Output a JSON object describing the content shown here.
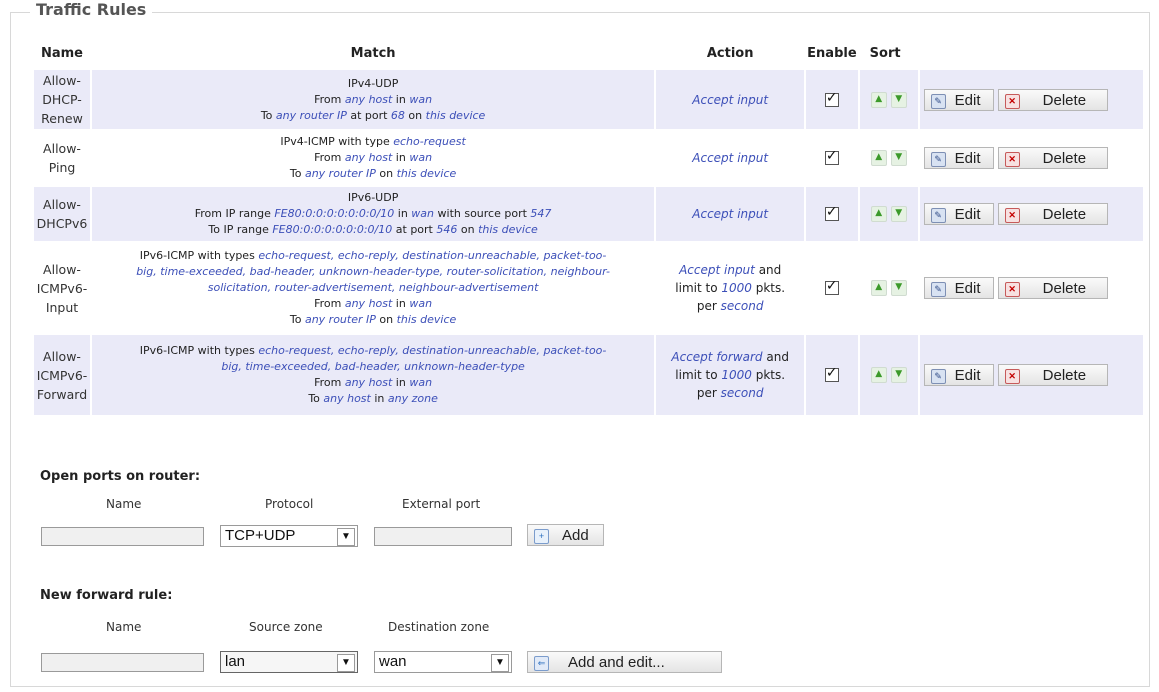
{
  "legend": "Traffic Rules",
  "columns": {
    "name": "Name",
    "match": "Match",
    "action": "Action",
    "enable": "Enable",
    "sort": "Sort"
  },
  "buttons": {
    "edit": "Edit",
    "delete": "Delete",
    "add": "Add",
    "add_edit": "Add and edit..."
  },
  "rules": [
    {
      "name": [
        "Allow-",
        "DHCP-",
        "Renew"
      ],
      "match": [
        [
          {
            "t": "IPv4-UDP"
          }
        ],
        [
          {
            "t": "From "
          },
          {
            "t": "any host",
            "k": 1
          },
          {
            "t": " in "
          },
          {
            "t": "wan",
            "k": 1
          }
        ],
        [
          {
            "t": "To "
          },
          {
            "t": "any router IP",
            "k": 1
          },
          {
            "t": " at port "
          },
          {
            "t": "68",
            "k": 1
          },
          {
            "t": " on "
          },
          {
            "t": "this device",
            "k": 1
          }
        ]
      ],
      "action": [
        [
          {
            "t": "Accept input",
            "k": 1
          }
        ]
      ],
      "enabled": true
    },
    {
      "name": [
        "Allow-",
        "Ping"
      ],
      "match": [
        [
          {
            "t": "IPv4-ICMP with type "
          },
          {
            "t": "echo-request",
            "k": 1
          }
        ],
        [
          {
            "t": "From "
          },
          {
            "t": "any host",
            "k": 1
          },
          {
            "t": " in "
          },
          {
            "t": "wan",
            "k": 1
          }
        ],
        [
          {
            "t": "To "
          },
          {
            "t": "any router IP",
            "k": 1
          },
          {
            "t": " on "
          },
          {
            "t": "this device",
            "k": 1
          }
        ]
      ],
      "action": [
        [
          {
            "t": "Accept input",
            "k": 1
          }
        ]
      ],
      "enabled": true
    },
    {
      "name": [
        "Allow-",
        "DHCPv6"
      ],
      "match": [
        [
          {
            "t": "IPv6-UDP"
          }
        ],
        [
          {
            "t": "From IP range "
          },
          {
            "t": "FE80:0:0:0:0:0:0:0/10",
            "k": 1
          },
          {
            "t": " in "
          },
          {
            "t": "wan",
            "k": 1
          },
          {
            "t": " with source port "
          },
          {
            "t": "547",
            "k": 1
          }
        ],
        [
          {
            "t": "To IP range "
          },
          {
            "t": "FE80:0:0:0:0:0:0:0/10",
            "k": 1
          },
          {
            "t": " at port "
          },
          {
            "t": "546",
            "k": 1
          },
          {
            "t": " on "
          },
          {
            "t": "this device",
            "k": 1
          }
        ]
      ],
      "action": [
        [
          {
            "t": "Accept input",
            "k": 1
          }
        ]
      ],
      "enabled": true
    },
    {
      "name": [
        "Allow-",
        "ICMPv6-",
        "Input"
      ],
      "match": [
        [
          {
            "t": "IPv6-ICMP with types "
          },
          {
            "t": "echo-request, echo-reply, destination-unreachable, packet-too-",
            "k": 1
          }
        ],
        [
          {
            "t": "big, time-exceeded, bad-header, unknown-header-type, router-solicitation, neighbour-",
            "k": 1
          }
        ],
        [
          {
            "t": "solicitation, router-advertisement, neighbour-advertisement",
            "k": 1
          }
        ],
        [
          {
            "t": "From "
          },
          {
            "t": "any host",
            "k": 1
          },
          {
            "t": " in "
          },
          {
            "t": "wan",
            "k": 1
          }
        ],
        [
          {
            "t": "To "
          },
          {
            "t": "any router IP",
            "k": 1
          },
          {
            "t": " on "
          },
          {
            "t": "this device",
            "k": 1
          }
        ]
      ],
      "action": [
        [
          {
            "t": "Accept input",
            "k": 1
          },
          {
            "t": " and"
          }
        ],
        [
          {
            "t": "limit to "
          },
          {
            "t": "1000",
            "k": 1
          },
          {
            "t": " pkts."
          }
        ],
        [
          {
            "t": "per "
          },
          {
            "t": "second",
            "k": 1
          }
        ]
      ],
      "enabled": true
    },
    {
      "name": [
        "Allow-",
        "ICMPv6-",
        "Forward"
      ],
      "match": [
        [
          {
            "t": "IPv6-ICMP with types "
          },
          {
            "t": "echo-request, echo-reply, destination-unreachable, packet-too-",
            "k": 1
          }
        ],
        [
          {
            "t": "big, time-exceeded, bad-header, unknown-header-type",
            "k": 1
          }
        ],
        [
          {
            "t": "From "
          },
          {
            "t": "any host",
            "k": 1
          },
          {
            "t": " in "
          },
          {
            "t": "wan",
            "k": 1
          }
        ],
        [
          {
            "t": "To "
          },
          {
            "t": "any host",
            "k": 1
          },
          {
            "t": " in "
          },
          {
            "t": "any zone",
            "k": 1
          }
        ]
      ],
      "action": [
        [
          {
            "t": "Accept forward",
            "k": 1
          },
          {
            "t": " and"
          }
        ],
        [
          {
            "t": "limit to "
          },
          {
            "t": "1000",
            "k": 1
          },
          {
            "t": " pkts."
          }
        ],
        [
          {
            "t": "per "
          },
          {
            "t": "second",
            "k": 1
          }
        ]
      ],
      "enabled": true
    }
  ],
  "open_ports": {
    "title": "Open ports on router:",
    "name_label": "Name",
    "protocol_label": "Protocol",
    "port_label": "External port",
    "protocol_value": "TCP+UDP"
  },
  "forward_rule": {
    "title": "New forward rule:",
    "name_label": "Name",
    "source_label": "Source zone",
    "dest_label": "Destination zone",
    "source_value": "lan",
    "dest_value": "wan"
  }
}
